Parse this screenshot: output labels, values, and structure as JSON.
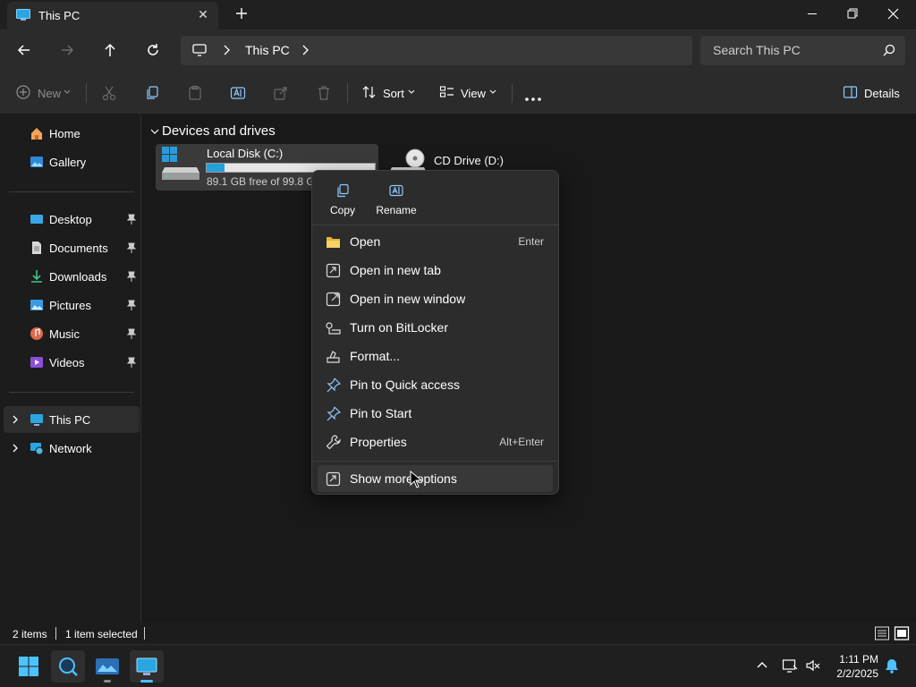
{
  "window": {
    "tab_title": "This PC",
    "tab_icon": "this-pc-icon",
    "close_tab_glyph": "✕"
  },
  "address_bar": {
    "location": "This PC",
    "search_placeholder": "Search This PC"
  },
  "command_bar": {
    "new_label": "New",
    "sort_label": "Sort",
    "view_label": "View",
    "details_label": "Details"
  },
  "sidebar": {
    "top_items": [
      {
        "label": "Home",
        "icon": "home-icon"
      },
      {
        "label": "Gallery",
        "icon": "gallery-icon"
      }
    ],
    "pinned_items": [
      {
        "label": "Desktop",
        "icon": "desktop-folder-icon"
      },
      {
        "label": "Documents",
        "icon": "documents-folder-icon"
      },
      {
        "label": "Downloads",
        "icon": "downloads-folder-icon"
      },
      {
        "label": "Pictures",
        "icon": "pictures-folder-icon"
      },
      {
        "label": "Music",
        "icon": "music-folder-icon"
      },
      {
        "label": "Videos",
        "icon": "videos-folder-icon"
      }
    ],
    "tree_items": [
      {
        "label": "This PC",
        "icon": "this-pc-icon",
        "selected": true
      },
      {
        "label": "Network",
        "icon": "network-icon",
        "selected": false
      }
    ]
  },
  "content": {
    "group_title": "Devices and drives",
    "drives": [
      {
        "name": "Local Disk (C:)",
        "free_text": "89.1 GB free of 99.8 GB",
        "used_fraction": 0.107,
        "selected": true
      },
      {
        "name": "CD Drive (D:)",
        "selected": false
      }
    ]
  },
  "status_bar": {
    "item_count": "2 items",
    "selection": "1 item selected"
  },
  "context_menu": {
    "quick_actions": [
      {
        "label": "Copy",
        "icon": "copy-icon"
      },
      {
        "label": "Rename",
        "icon": "rename-icon"
      }
    ],
    "items": [
      {
        "label": "Open",
        "shortcut": "Enter",
        "icon": "folder-open-icon"
      },
      {
        "label": "Open in new tab",
        "shortcut": "",
        "icon": "new-tab-icon"
      },
      {
        "label": "Open in new window",
        "shortcut": "",
        "icon": "new-window-icon"
      },
      {
        "label": "Turn on BitLocker",
        "shortcut": "",
        "icon": "bitlocker-key-icon"
      },
      {
        "label": "Format...",
        "shortcut": "",
        "icon": "format-drive-icon"
      },
      {
        "label": "Pin to Quick access",
        "shortcut": "",
        "icon": "pin-icon"
      },
      {
        "label": "Pin to Start",
        "shortcut": "",
        "icon": "pin-icon"
      },
      {
        "label": "Properties",
        "shortcut": "Alt+Enter",
        "icon": "wrench-icon"
      }
    ],
    "more_options": {
      "label": "Show more options",
      "icon": "more-options-icon"
    }
  },
  "taskbar": {
    "apps": [
      "start-icon",
      "search-icon",
      "widgets-icon",
      "file-explorer-icon"
    ],
    "time": "1:11 PM",
    "date": "2/2/2025"
  },
  "colors": {
    "accent": "#4cc2ff",
    "drive_bar_fill": "#26a0da",
    "menu_bg": "#2c2c2c",
    "window_bg": "#191919"
  }
}
